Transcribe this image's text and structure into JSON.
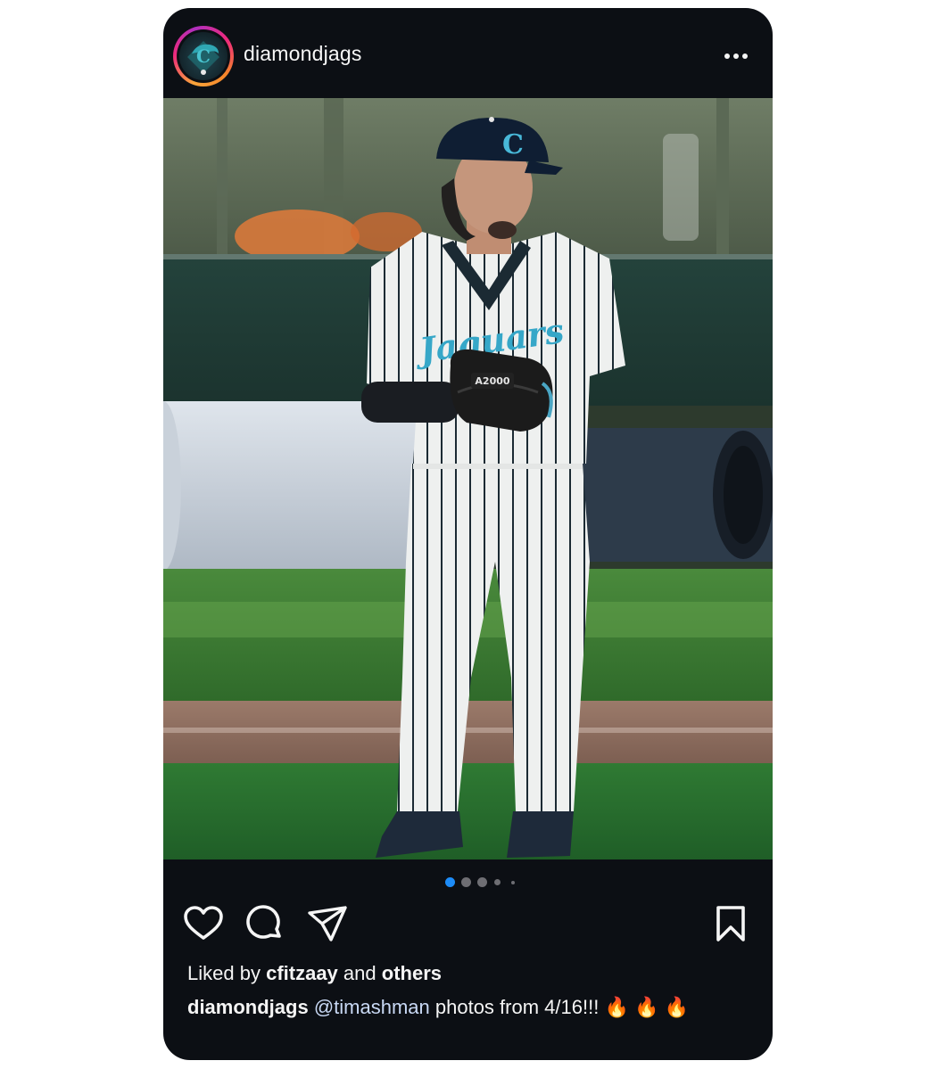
{
  "post": {
    "username": "diamondjags",
    "avatar_icon": "jaguar-logo-icon",
    "more_icon": "more-options-icon",
    "photo": {
      "cap_letter": "C",
      "jersey_text": "Jaguars",
      "glove_text": "A2000"
    },
    "carousel": {
      "total_dots": 5,
      "active_index": 0,
      "active_color": "#1d8cf8"
    },
    "actions": {
      "like_icon": "heart-icon",
      "comment_icon": "comment-icon",
      "share_icon": "paper-plane-icon",
      "save_icon": "bookmark-icon"
    },
    "likes": {
      "prefix": "Liked by",
      "user": "cfitzaay",
      "conjunction": "and",
      "others": "others"
    },
    "caption": {
      "author": "diamondjags",
      "mention": "@timashman",
      "text": "photos from 4/16!!!",
      "emojis": "🔥 🔥 🔥"
    }
  }
}
